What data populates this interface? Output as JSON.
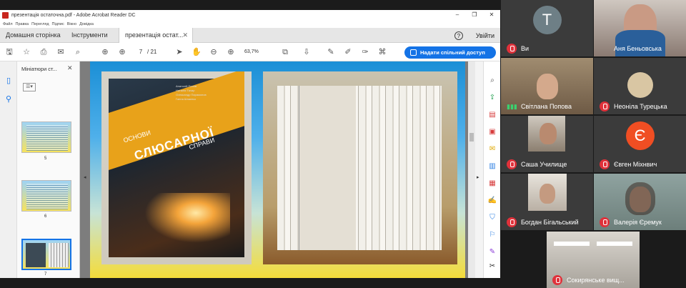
{
  "acrobat": {
    "window_title": "презентація остаточна.pdf - Adobe Acrobat Reader DC",
    "menu": [
      "Файл",
      "Правка",
      "Перегляд",
      "Підпис",
      "Вікно",
      "Довідка"
    ],
    "tabs": {
      "home": "Домашня сторінка",
      "tools": "Інструменти",
      "doc": "презентація остат..."
    },
    "sign_in": "Увійти",
    "page_current": "7",
    "page_total": "/ 21",
    "zoom": "63,7%",
    "share_button": "Надати спільний доступ",
    "thumbnails": {
      "title": "Мініатюри ст...",
      "pages": [
        "5",
        "6",
        "7"
      ]
    }
  },
  "cover": {
    "authors": [
      "Анатолій Попов",
      "Наталія Тачар",
      "Олександр Парамонов",
      "Ганна Шпаєнко"
    ],
    "sub1": "ОСНОВИ",
    "main": "СЛЮСАРНОЇ",
    "sub2": "СПРАВИ"
  },
  "participants": [
    {
      "name": "Ви",
      "avatar": "Т",
      "muted": true
    },
    {
      "name": "Аня Беньовська",
      "muted": false
    },
    {
      "name": "Світлана Попова",
      "muted": false
    },
    {
      "name": "Неоніла Турецька",
      "muted": true
    },
    {
      "name": "Саша Училище",
      "muted": true
    },
    {
      "name": "Євген Міхнвич",
      "avatar": "Є",
      "muted": true
    },
    {
      "name": "Богдан Бігальський",
      "muted": true
    },
    {
      "name": "Валерія Єремук",
      "muted": true
    },
    {
      "name": "Сокирянське вищ...",
      "muted": true
    }
  ],
  "colors": {
    "accent": "#1473e6",
    "muted": "#e0313a",
    "avatar_t": "#6e7f86",
    "avatar_e": "#f04e23"
  }
}
